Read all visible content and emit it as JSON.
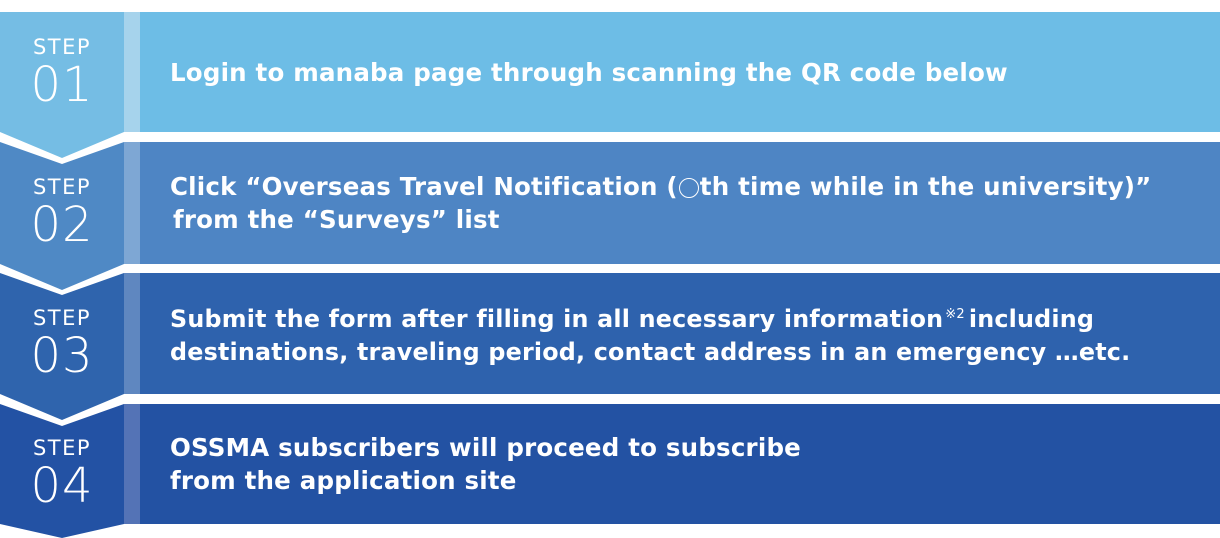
{
  "steps": [
    {
      "step_label": "STEP",
      "number": "01",
      "line1": "Login to manaba page through scanning the QR code below",
      "line2": "",
      "tab_color": "#75bde4",
      "divider_color": "#a6d3ec",
      "body_color": "#6dbde6"
    },
    {
      "step_label": "STEP",
      "number": "02",
      "line1_pre": "Click “Overseas Travel Notification (",
      "line1_post": "th time while in the university)”",
      "line2": "from the “Surveys” list",
      "tab_color": "#4f89c5",
      "divider_color": "#7ea7d4",
      "body_color": "#4e85c4"
    },
    {
      "step_label": "STEP",
      "number": "03",
      "line1_pre": "Submit the form after filling in all necessary information",
      "note_mark": "※2",
      "line1_post": "including",
      "line2": "destinations, traveling period, contact address in an emergency …etc.",
      "tab_color": "#2f64ad",
      "divider_color": "#5f87c0",
      "body_color": "#2e62ad"
    },
    {
      "step_label": "STEP",
      "number": "04",
      "line1": "OSSMA subscribers will proceed to subscribe",
      "line2": "from the application site",
      "tab_color": "#2352a4",
      "divider_color": "#5473b6",
      "body_color": "#2352a3"
    }
  ]
}
